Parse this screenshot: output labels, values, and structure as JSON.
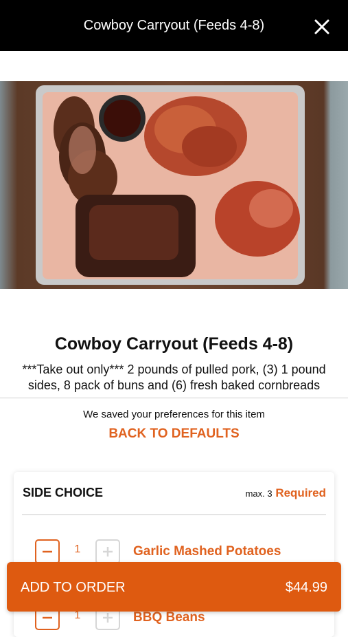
{
  "header": {
    "title": "Cowboy Carryout (Feeds 4-8)",
    "close_icon": "close-icon"
  },
  "hero": {
    "alt": "Tray of smoked brisket, pulled pork, ribs and sauce"
  },
  "item": {
    "title": "Cowboy Carryout (Feeds 4-8)",
    "description": "***Take out only*** 2 pounds of pulled pork, (3) 1 pound sides, 8 pack of buns and (6) fresh baked cornbreads"
  },
  "preferences": {
    "saved_text": "We saved your preferences for this item",
    "back_label": "BACK TO DEFAULTS"
  },
  "side_choice": {
    "title": "SIDE CHOICE",
    "max_label": "max. 3",
    "required_label": "Required",
    "options": [
      {
        "qty": "1",
        "name": "Garlic Mashed Potatoes"
      },
      {
        "qty": "1",
        "name": "BBQ Beans"
      }
    ]
  },
  "order_bar": {
    "label": "ADD TO ORDER",
    "price": "$44.99"
  },
  "colors": {
    "accent": "#e0621f",
    "button": "#de5a10",
    "header": "#000000"
  }
}
